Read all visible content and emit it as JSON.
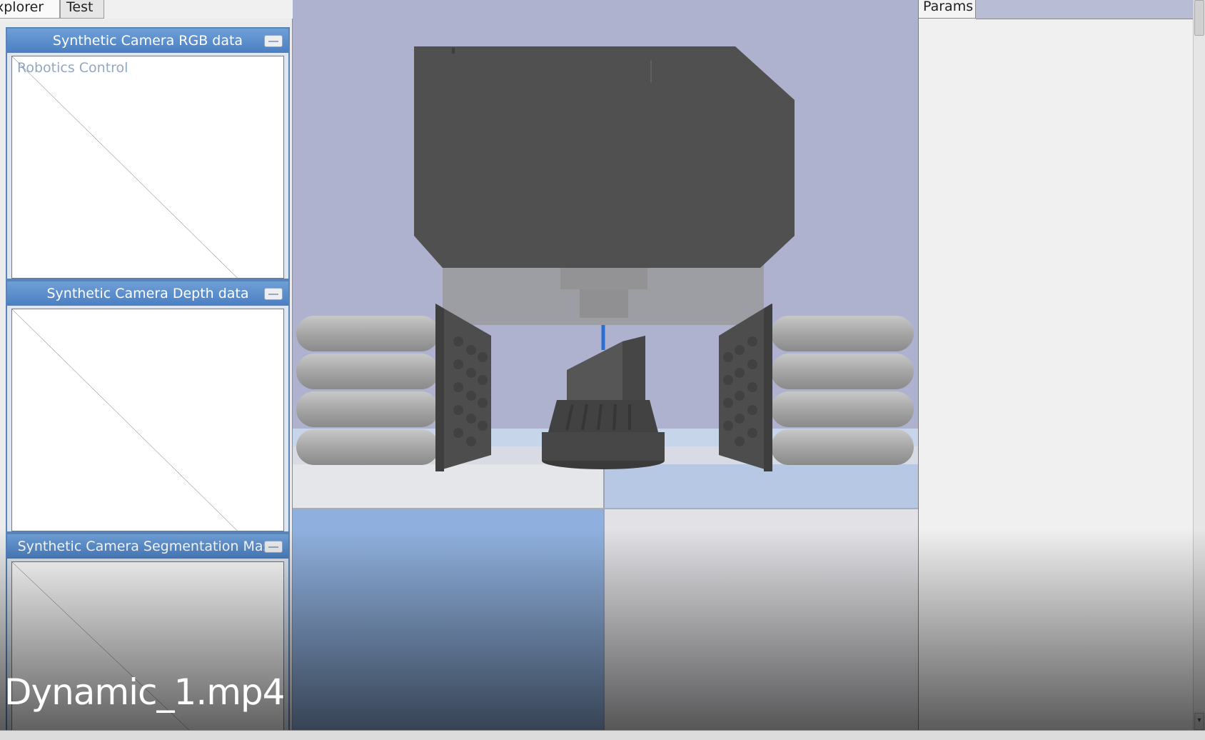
{
  "left_tabs": {
    "explorer": "xplorer",
    "test": "Test"
  },
  "ghost_label": "Robotics Control",
  "camera_panels": [
    {
      "title": "Synthetic Camera RGB data"
    },
    {
      "title": "Synthetic Camera Depth data"
    },
    {
      "title": "Synthetic Camera Segmentation Mask"
    }
  ],
  "right_panel": {
    "tab": "Params"
  },
  "video_label": "Dynamic_1.mp4",
  "colors": {
    "title_bar": "#4a7fc2",
    "sky": "#aeb2cf",
    "robot_body": "#505050",
    "floor_blue": "#8fb0de"
  }
}
